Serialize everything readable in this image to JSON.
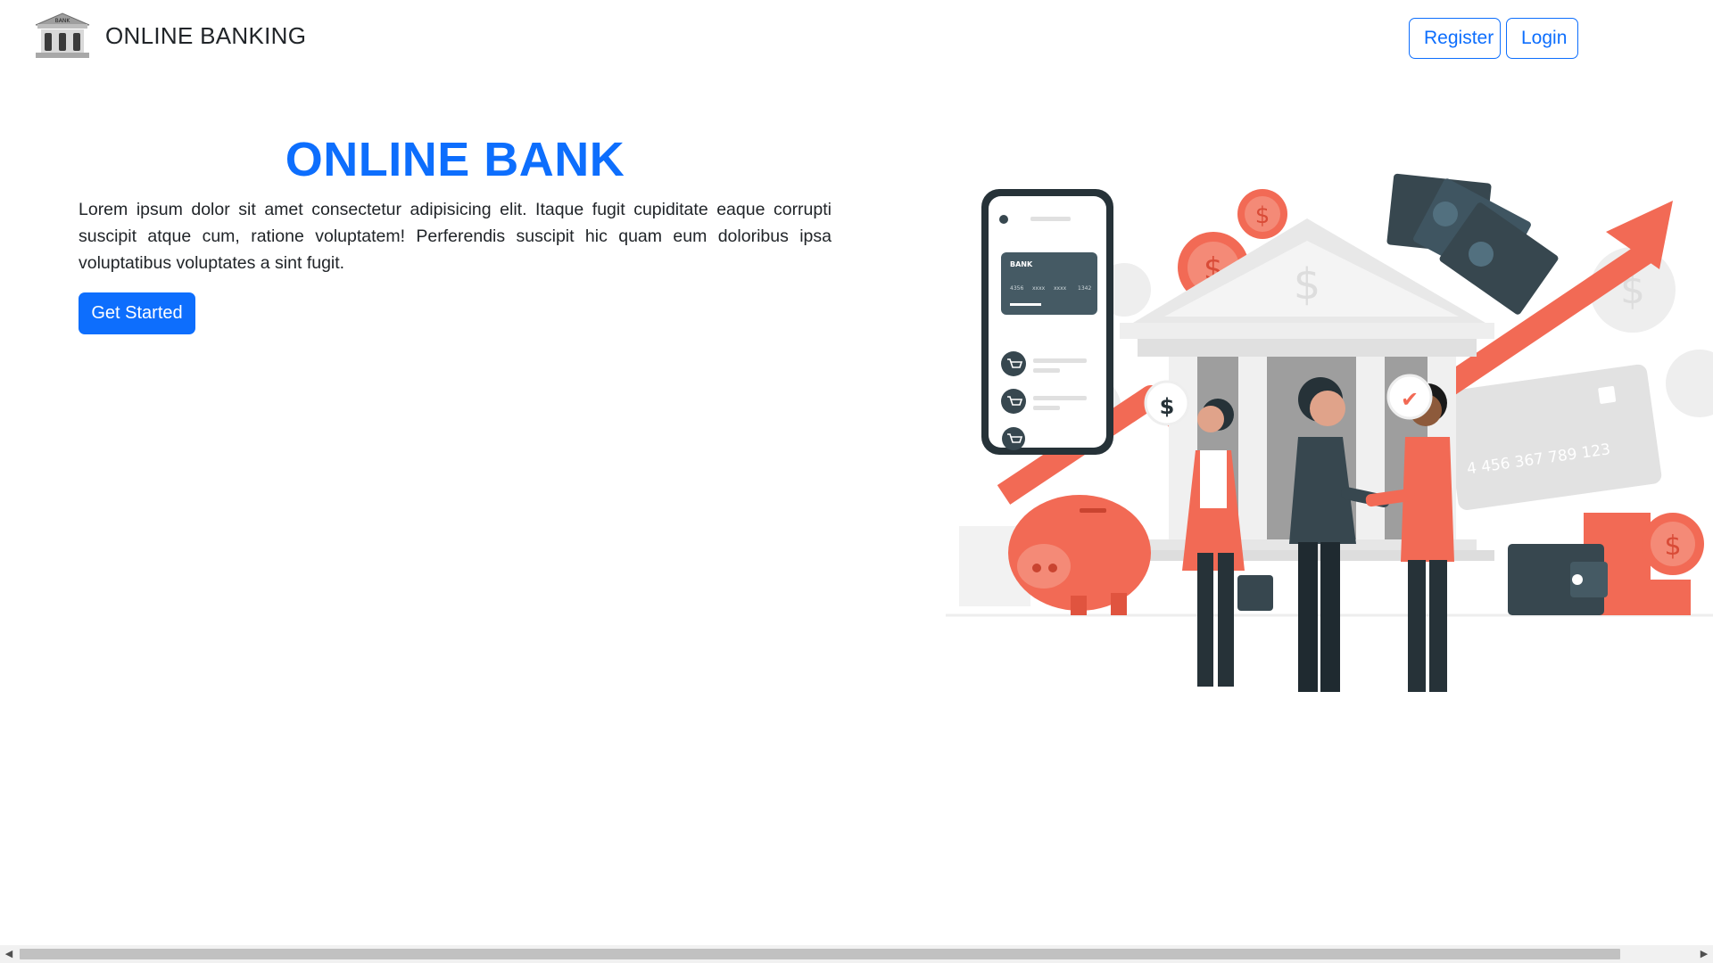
{
  "brand": {
    "name": "ONLINE BANKING",
    "logo_text": "BANK",
    "logo_icon": "bank-building-icon"
  },
  "nav": {
    "register_label": "Register",
    "login_label": "Login"
  },
  "hero": {
    "title": "ONLINE BANK",
    "description": "Lorem ipsum dolor sit amet consectetur adipisicing elit. Itaque fugit cupiditate eaque corrupti suscipit atque cum, ratione voluptatem! Perferendis suscipit hic quam eum doloribus ipsa voluptatibus voluptates a sint fugit.",
    "cta_label": "Get Started"
  },
  "illustration": {
    "card_label": "BANK",
    "card_number_parts": [
      "4356",
      "xxxx",
      "xxxx",
      "1342"
    ],
    "big_card_number": "4 456 367 789 123",
    "dollar_sign": "$",
    "check": "✔"
  },
  "colors": {
    "primary": "#0d6efd",
    "accent": "#f26a55",
    "dark": "#37474f"
  },
  "scrollbar": {
    "left_icon": "arrow-left-icon",
    "right_icon": "arrow-right-icon"
  }
}
